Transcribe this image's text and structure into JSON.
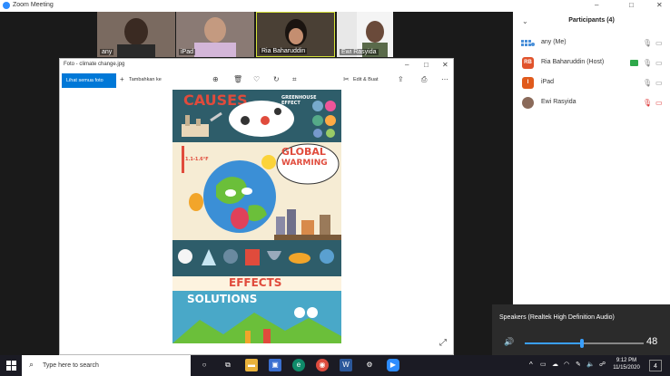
{
  "zoom": {
    "title": "Zoom Meeting",
    "window_controls": [
      "–",
      "□",
      "✕"
    ]
  },
  "video_strip": [
    {
      "name": "any"
    },
    {
      "name": "iPad"
    },
    {
      "name": "Ria Baharuddin"
    },
    {
      "name": "Ewi Rasyida"
    }
  ],
  "participants": {
    "title": "Participants (4)",
    "collapse": "⌄",
    "list": [
      {
        "name": "any (Me)",
        "initials": "",
        "color": "#4a90d9"
      },
      {
        "name": "Ria Baharuddin (Host)",
        "initials": "RB",
        "color": "#e0532c"
      },
      {
        "name": "iPad",
        "initials": "I",
        "color": "#e05a1c"
      },
      {
        "name": "Ewi Rasyida",
        "initials": "",
        "color": "#8a6a5a"
      }
    ]
  },
  "photos": {
    "title": "Foto - climate change.jpg",
    "view_all": "Lihat semua foto",
    "add_to": "Tambahkan ke",
    "edit_create": "Edit & Buat",
    "window_controls": [
      "–",
      "□",
      "✕"
    ]
  },
  "poster": {
    "causes": "CAUSES",
    "greenhouse": "GREENHOUSE EFFECT",
    "temp": "1.1-1.6°F",
    "global": "GLOBAL",
    "warming": "WARMING",
    "effects": "EFFECTS",
    "solutions": "SOLUTIONS"
  },
  "speakers": {
    "label": "Speakers (Realtek High Definition Audio)",
    "volume": 48
  },
  "taskbar": {
    "search_placeholder": "Type here to search",
    "time": "9:12 PM",
    "date": "11/15/2020",
    "notifications": "4"
  },
  "colors": {
    "accent": "#0078d7",
    "zoom_blue": "#2d8cff",
    "panel_bg": "#ffffff",
    "dark_bg": "#1a1a1a"
  }
}
